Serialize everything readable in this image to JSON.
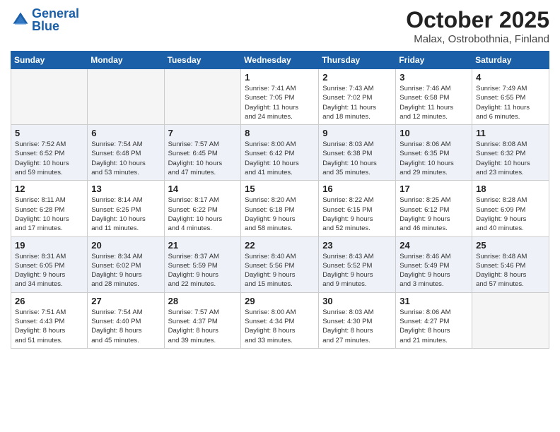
{
  "header": {
    "logo_text_general": "General",
    "logo_text_blue": "Blue",
    "month": "October 2025",
    "location": "Malax, Ostrobothnia, Finland"
  },
  "days_of_week": [
    "Sunday",
    "Monday",
    "Tuesday",
    "Wednesday",
    "Thursday",
    "Friday",
    "Saturday"
  ],
  "weeks": [
    [
      {
        "day": "",
        "info": ""
      },
      {
        "day": "",
        "info": ""
      },
      {
        "day": "",
        "info": ""
      },
      {
        "day": "1",
        "info": "Sunrise: 7:41 AM\nSunset: 7:05 PM\nDaylight: 11 hours\nand 24 minutes."
      },
      {
        "day": "2",
        "info": "Sunrise: 7:43 AM\nSunset: 7:02 PM\nDaylight: 11 hours\nand 18 minutes."
      },
      {
        "day": "3",
        "info": "Sunrise: 7:46 AM\nSunset: 6:58 PM\nDaylight: 11 hours\nand 12 minutes."
      },
      {
        "day": "4",
        "info": "Sunrise: 7:49 AM\nSunset: 6:55 PM\nDaylight: 11 hours\nand 6 minutes."
      }
    ],
    [
      {
        "day": "5",
        "info": "Sunrise: 7:52 AM\nSunset: 6:52 PM\nDaylight: 10 hours\nand 59 minutes."
      },
      {
        "day": "6",
        "info": "Sunrise: 7:54 AM\nSunset: 6:48 PM\nDaylight: 10 hours\nand 53 minutes."
      },
      {
        "day": "7",
        "info": "Sunrise: 7:57 AM\nSunset: 6:45 PM\nDaylight: 10 hours\nand 47 minutes."
      },
      {
        "day": "8",
        "info": "Sunrise: 8:00 AM\nSunset: 6:42 PM\nDaylight: 10 hours\nand 41 minutes."
      },
      {
        "day": "9",
        "info": "Sunrise: 8:03 AM\nSunset: 6:38 PM\nDaylight: 10 hours\nand 35 minutes."
      },
      {
        "day": "10",
        "info": "Sunrise: 8:06 AM\nSunset: 6:35 PM\nDaylight: 10 hours\nand 29 minutes."
      },
      {
        "day": "11",
        "info": "Sunrise: 8:08 AM\nSunset: 6:32 PM\nDaylight: 10 hours\nand 23 minutes."
      }
    ],
    [
      {
        "day": "12",
        "info": "Sunrise: 8:11 AM\nSunset: 6:28 PM\nDaylight: 10 hours\nand 17 minutes."
      },
      {
        "day": "13",
        "info": "Sunrise: 8:14 AM\nSunset: 6:25 PM\nDaylight: 10 hours\nand 11 minutes."
      },
      {
        "day": "14",
        "info": "Sunrise: 8:17 AM\nSunset: 6:22 PM\nDaylight: 10 hours\nand 4 minutes."
      },
      {
        "day": "15",
        "info": "Sunrise: 8:20 AM\nSunset: 6:18 PM\nDaylight: 9 hours\nand 58 minutes."
      },
      {
        "day": "16",
        "info": "Sunrise: 8:22 AM\nSunset: 6:15 PM\nDaylight: 9 hours\nand 52 minutes."
      },
      {
        "day": "17",
        "info": "Sunrise: 8:25 AM\nSunset: 6:12 PM\nDaylight: 9 hours\nand 46 minutes."
      },
      {
        "day": "18",
        "info": "Sunrise: 8:28 AM\nSunset: 6:09 PM\nDaylight: 9 hours\nand 40 minutes."
      }
    ],
    [
      {
        "day": "19",
        "info": "Sunrise: 8:31 AM\nSunset: 6:05 PM\nDaylight: 9 hours\nand 34 minutes."
      },
      {
        "day": "20",
        "info": "Sunrise: 8:34 AM\nSunset: 6:02 PM\nDaylight: 9 hours\nand 28 minutes."
      },
      {
        "day": "21",
        "info": "Sunrise: 8:37 AM\nSunset: 5:59 PM\nDaylight: 9 hours\nand 22 minutes."
      },
      {
        "day": "22",
        "info": "Sunrise: 8:40 AM\nSunset: 5:56 PM\nDaylight: 9 hours\nand 15 minutes."
      },
      {
        "day": "23",
        "info": "Sunrise: 8:43 AM\nSunset: 5:52 PM\nDaylight: 9 hours\nand 9 minutes."
      },
      {
        "day": "24",
        "info": "Sunrise: 8:46 AM\nSunset: 5:49 PM\nDaylight: 9 hours\nand 3 minutes."
      },
      {
        "day": "25",
        "info": "Sunrise: 8:48 AM\nSunset: 5:46 PM\nDaylight: 8 hours\nand 57 minutes."
      }
    ],
    [
      {
        "day": "26",
        "info": "Sunrise: 7:51 AM\nSunset: 4:43 PM\nDaylight: 8 hours\nand 51 minutes."
      },
      {
        "day": "27",
        "info": "Sunrise: 7:54 AM\nSunset: 4:40 PM\nDaylight: 8 hours\nand 45 minutes."
      },
      {
        "day": "28",
        "info": "Sunrise: 7:57 AM\nSunset: 4:37 PM\nDaylight: 8 hours\nand 39 minutes."
      },
      {
        "day": "29",
        "info": "Sunrise: 8:00 AM\nSunset: 4:34 PM\nDaylight: 8 hours\nand 33 minutes."
      },
      {
        "day": "30",
        "info": "Sunrise: 8:03 AM\nSunset: 4:30 PM\nDaylight: 8 hours\nand 27 minutes."
      },
      {
        "day": "31",
        "info": "Sunrise: 8:06 AM\nSunset: 4:27 PM\nDaylight: 8 hours\nand 21 minutes."
      },
      {
        "day": "",
        "info": ""
      }
    ]
  ],
  "row_shaded": [
    false,
    true,
    false,
    true,
    false
  ]
}
